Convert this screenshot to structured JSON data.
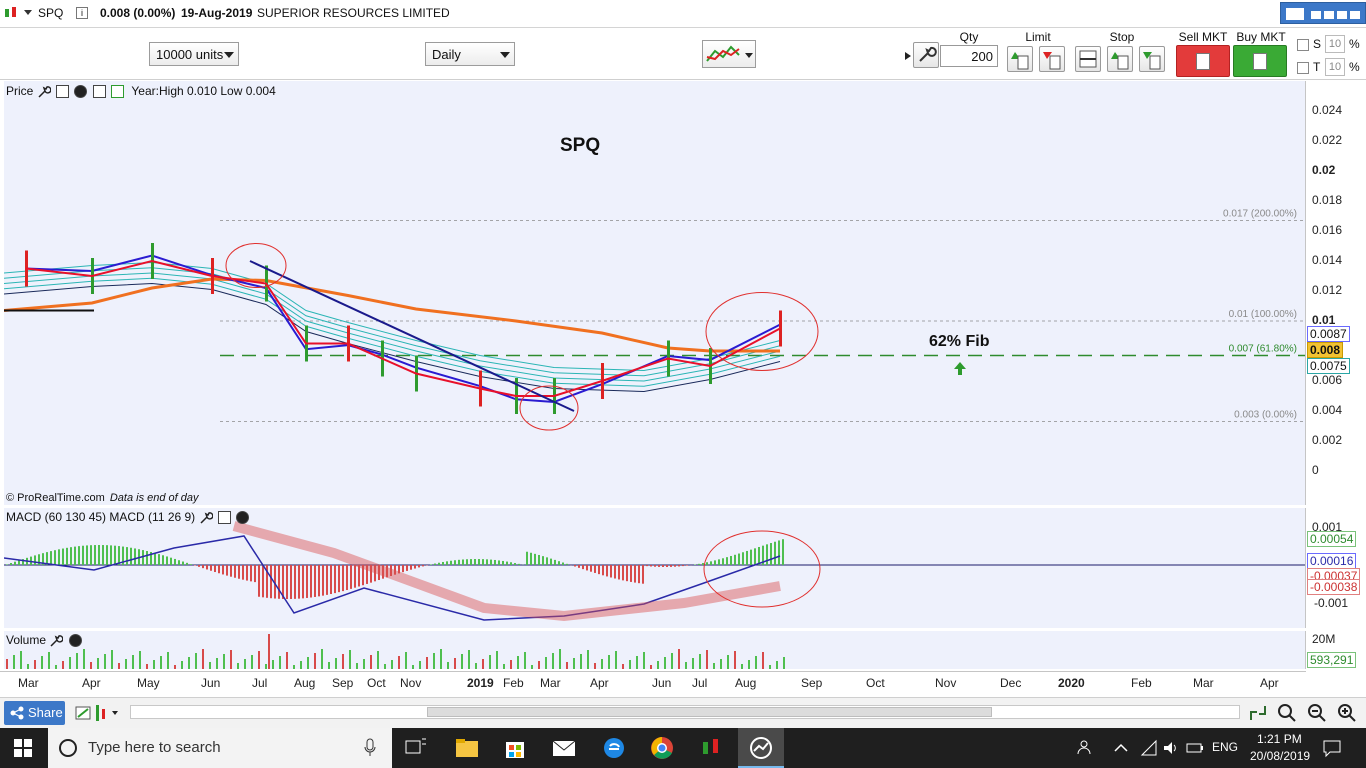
{
  "title_bar": {
    "symbol": "SPQ",
    "price_change": "0.008 (0.00%)",
    "date": "19-Aug-2019",
    "company": "SUPERIOR RESOURCES LIMITED"
  },
  "toolbar": {
    "units_select": "10000 units",
    "interval_select": "Daily",
    "qty_label": "Qty",
    "qty_value": "200",
    "limit_label": "Limit",
    "stop_label": "Stop",
    "sell_label": "Sell MKT",
    "buy_label": "Buy MKT",
    "s_label": "S",
    "t_label": "T",
    "s_pct": "10",
    "t_pct": "10",
    "pct_sign": "%"
  },
  "price_panel": {
    "label": "Price",
    "year_range": "Year:High 0.010 Low 0.004",
    "chart_title": "SPQ",
    "fib_annotation": "62% Fib",
    "fib_levels": [
      {
        "label": "0.017 (200.00%)",
        "value": 0.0167
      },
      {
        "label": "0.01 (100.00%)",
        "value": 0.01
      },
      {
        "label": "0.007 (61.80%)",
        "value": 0.0077
      },
      {
        "label": "0.003 (0.00%)",
        "value": 0.0033
      }
    ],
    "y_ticks": [
      "0.024",
      "0.022",
      "0.02",
      "0.018",
      "0.016",
      "0.014",
      "0.012",
      "0.01",
      "0.008",
      "0.006",
      "0.004",
      "0.002",
      "0"
    ],
    "price_tags": [
      "0.0087",
      "0.008",
      "0.0075"
    ],
    "copyright": "© ProRealTime.com",
    "data_note": "Data is end of day"
  },
  "macd_panel": {
    "label": "MACD (60 130 45) MACD (11 26 9)",
    "y_ticks": [
      "0.001",
      "-0.001"
    ],
    "value_tags": [
      "0.00054",
      "0.00016",
      "-0.00037",
      "-0.00038"
    ]
  },
  "volume_panel": {
    "label": "Volume",
    "y_ticks": [
      "20M"
    ],
    "value_tag": "593,291"
  },
  "x_axis": {
    "labels": [
      "Mar",
      "Apr",
      "May",
      "Jun",
      "Jul",
      "Aug",
      "Sep",
      "Oct",
      "Nov",
      "2019",
      "Feb",
      "Mar",
      "Apr",
      "Jun",
      "Jul",
      "Aug",
      "Sep",
      "Oct",
      "Nov",
      "Dec",
      "2020",
      "Feb",
      "Mar",
      "Apr"
    ]
  },
  "bottom_bar": {
    "share_label": "Share"
  },
  "taskbar": {
    "search_placeholder": "Type here to search",
    "language": "ENG",
    "time": "1:21 PM",
    "date": "20/08/2019"
  },
  "chart_data": {
    "type": "line",
    "title": "SPQ",
    "x": [
      "Mar 2018",
      "Apr 2018",
      "May 2018",
      "Jun 2018",
      "Jul 2018",
      "Aug 2018",
      "Sep 2018",
      "Oct 2018",
      "Nov 2018",
      "2019",
      "Feb 2019",
      "Mar 2019",
      "Apr 2019",
      "Jun 2019",
      "Jul 2019",
      "Aug 2019"
    ],
    "series": [
      {
        "values": [
          0.0135,
          0.013,
          0.014,
          0.013,
          0.0125,
          0.0085,
          0.0085,
          0.0075,
          0.0065,
          0.0055,
          0.005,
          0.005,
          0.006,
          0.0075,
          0.007,
          0.0095
        ]
      }
    ],
    "fib_levels": [
      0.0167,
      0.01,
      0.0077,
      0.0033
    ],
    "ylim": [
      0,
      0.025
    ],
    "colors": {
      "close": "#e8102a",
      "ma_short": "#2a1bd1",
      "ma_long": "#f07020",
      "fib_62": "#2e8b2e",
      "trendline": "#1a1a8c",
      "circle": "#e0302e"
    }
  }
}
